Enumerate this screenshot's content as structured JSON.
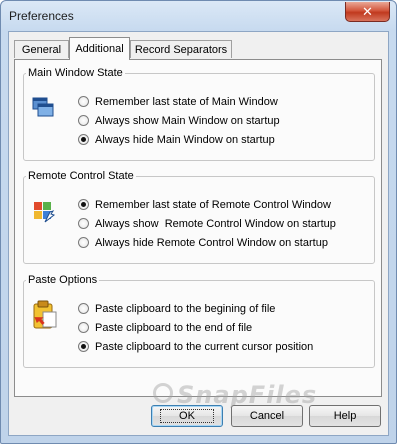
{
  "window": {
    "title": "Preferences",
    "close_glyph": "✕"
  },
  "tabs": [
    {
      "label": "General",
      "active": false
    },
    {
      "label": "Additional",
      "active": true
    },
    {
      "label": "Record Separators",
      "active": false
    }
  ],
  "groups": {
    "main_window": {
      "title": "Main Window State",
      "icon": "windows-icon",
      "options": [
        {
          "label": "Remember last state of Main Window",
          "checked": false
        },
        {
          "label": "Always show Main Window on startup",
          "checked": false
        },
        {
          "label": "Always hide Main Window on startup",
          "checked": true
        }
      ]
    },
    "remote_control": {
      "title": "Remote Control State",
      "icon": "remote-control-icon",
      "options": [
        {
          "label": "Remember last state of Remote Control Window",
          "checked": true
        },
        {
          "label": "Always show  Remote Control Window on startup",
          "checked": false
        },
        {
          "label": "Always hide Remote Control Window on startup",
          "checked": false
        }
      ]
    },
    "paste": {
      "title": "Paste Options",
      "icon": "clipboard-paste-icon",
      "options": [
        {
          "label": "Paste clipboard to the begining of file",
          "checked": false
        },
        {
          "label": "Paste clipboard to the end of file",
          "checked": false
        },
        {
          "label": "Paste clipboard to the current cursor position",
          "checked": true
        }
      ]
    }
  },
  "buttons": {
    "ok": "OK",
    "cancel": "Cancel",
    "help": "Help"
  },
  "watermark": "SnapFiles"
}
